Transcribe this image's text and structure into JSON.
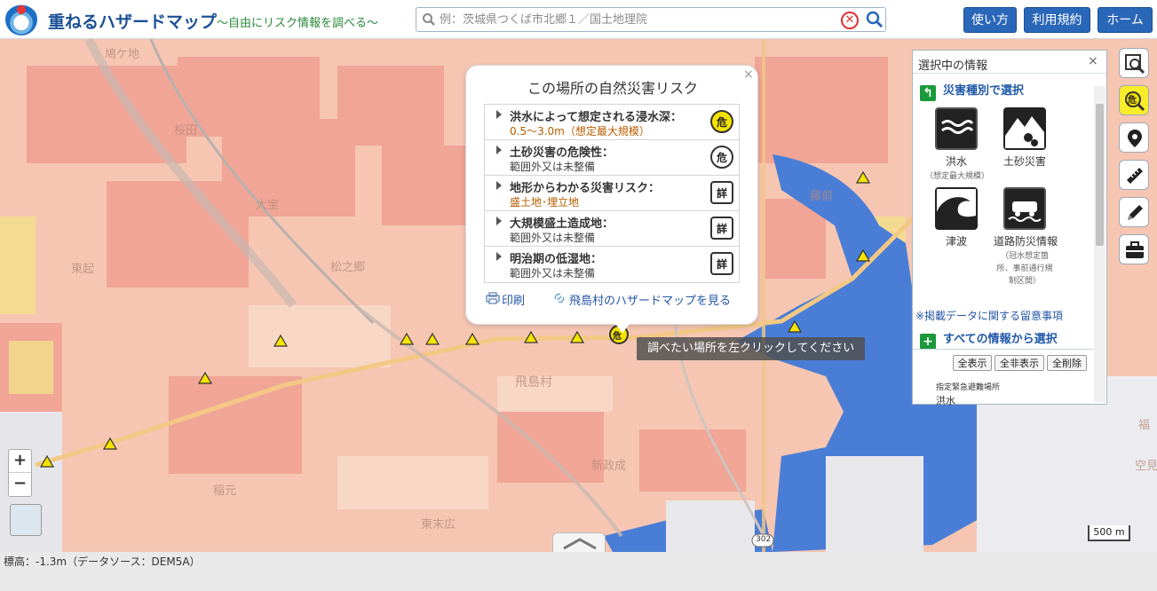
{
  "header": {
    "title": "重ねるハザードマップ",
    "subtitle": "〜自由にリスク情報を調べる〜",
    "search_placeholder": "例：茨城県つくば市北郷１／国土地理院",
    "clear_symbol": "✕",
    "nav": [
      {
        "label": "使い方"
      },
      {
        "label": "利用規約"
      },
      {
        "label": "ホーム"
      }
    ]
  },
  "popup": {
    "title": "この場所の自然災害リスク",
    "close_symbol": "×",
    "rows": [
      {
        "label": "洪水によって想定される浸水深：",
        "value": "0.5～3.0m（想定最大規模）",
        "icon_text": "危"
      },
      {
        "label": "土砂災害の危険性：",
        "value": "範囲外又は未整備",
        "icon_text": "危"
      },
      {
        "label": "地形からわかる災害リスク：",
        "value": "盛土地･埋立地",
        "icon_text": "詳"
      },
      {
        "label": "大規模盛土造成地：",
        "value": "範囲外又は未整備",
        "icon_text": "詳"
      },
      {
        "label": "明治期の低湿地：",
        "value": "範囲外又は未整備",
        "icon_text": "詳"
      }
    ],
    "print_label": "印刷",
    "hazard_map_link": "飛島村のハザードマップを見る"
  },
  "tooltip": "調べたい場所を左クリックしてください",
  "panel": {
    "title": "選択中の情報",
    "close_symbol": "×",
    "section_by_type": "災害種別で選択",
    "tiles": [
      {
        "label": "洪水",
        "sub": "（想定最大規模）"
      },
      {
        "label": "土砂災害",
        "sub": ""
      },
      {
        "label": "津波",
        "sub": ""
      },
      {
        "label": "道路防災情報",
        "sub": "（冠水想定箇所、事前通行規制区間）"
      }
    ],
    "note_link": "※掲載データに関する留意事項",
    "section_all": "すべての情報から選択",
    "buttons": [
      {
        "label": "全表示"
      },
      {
        "label": "全非表示"
      },
      {
        "label": "全削除"
      }
    ],
    "shelter_label": "指定緊急避難場所",
    "shelter_sub": "洪水"
  },
  "map": {
    "labels": [
      "鳩ケ地",
      "桜田",
      "大宝",
      "東起",
      "飛島村",
      "新政成",
      "稲元",
      "東末広",
      "藤前",
      "空見",
      "松之郷",
      "福"
    ],
    "road_number": "302",
    "scale_label": "500 m"
  },
  "elevation_text": "標高：-1.3m（データソース：DEM5A）",
  "colors": {
    "header_blue": "#2a67b8",
    "flood_pink": "#f6c6b2",
    "water_blue": "#4a7ed6",
    "warning_yellow": "#f9ec2a"
  }
}
